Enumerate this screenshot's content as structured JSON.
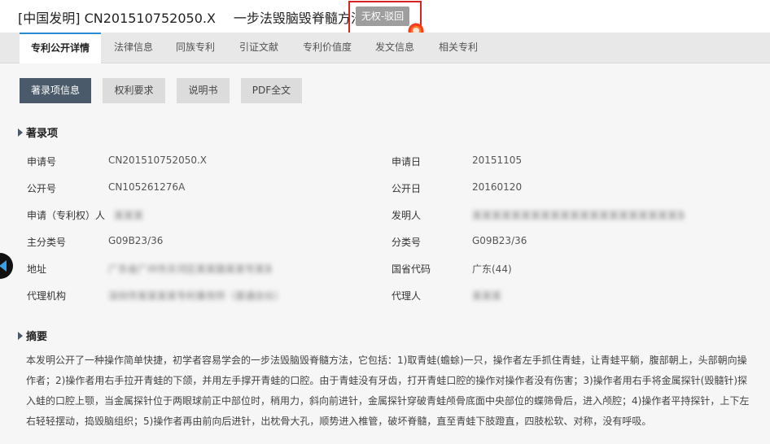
{
  "header": {
    "prefix": "[中国发明] CN201510752050.X",
    "title": "一步法毁脑毁脊髓方法",
    "status": "无权-驳回"
  },
  "tabs": [
    "专利公开详情",
    "法律信息",
    "同族专利",
    "引证文献",
    "专利价值度",
    "发文信息",
    "相关专利"
  ],
  "subtabs": [
    "著录项信息",
    "权利要求",
    "说明书",
    "PDF全文"
  ],
  "bibliography": {
    "heading": "著录项",
    "rows": [
      {
        "label": "申请号",
        "value": "CN201510752050.X",
        "label2": "申请日",
        "value2": "20151105"
      },
      {
        "label": "公开号",
        "value": "CN105261276A",
        "label2": "公开日",
        "value2": "20160120"
      },
      {
        "label": "申请（专利权）人",
        "value": "某某某",
        "label2": "发明人",
        "value2": "某某某某某某某某某某某某某某某某某某某某某某某某某"
      },
      {
        "label": "主分类号",
        "value": "G09B23/36",
        "label2": "分类号",
        "value2": "G09B23/36"
      },
      {
        "label": "地址",
        "value": "广东省广州市天河区某某路某某号某某某某",
        "label2": "国省代码",
        "value2": "广东(44)"
      },
      {
        "label": "代理机构",
        "value": "深圳市某某某某专利事务所（普通合伙）",
        "label2": "代理人",
        "value2": "某某某"
      }
    ]
  },
  "abstract": {
    "heading": "摘要",
    "text": "本发明公开了一种操作简单快捷，初学者容易学会的一步法毁脑毁脊髓方法，它包括：1)取青蛙(蟾蜍)一只，操作者左手抓住青蛙，让青蛙平躺，腹部朝上，头部朝向操作者；2)操作者用右手拉开青蛙的下颌，并用左手撑开青蛙的口腔。由于青蛙没有牙齿，打开青蛙口腔的操作对操作者没有伤害；3)操作者用右手将金属探针(毁髓针)探入蛙的口腔上颚，当金属探针位于两眼球前正中部位时，稍用力，斜向前进针，金属探针穿破青蛙颅骨底面中央部位的蝶筛骨后，进入颅腔；4)操作者平持探针，上下左右轻轻摆动，捣毁脑组织；5)操作者再由前向后进针，出枕骨大孔，顺势进入椎管，破坏脊髓，直至青蛙下肢蹬直，四肢松软、对称，没有呼吸。"
  }
}
